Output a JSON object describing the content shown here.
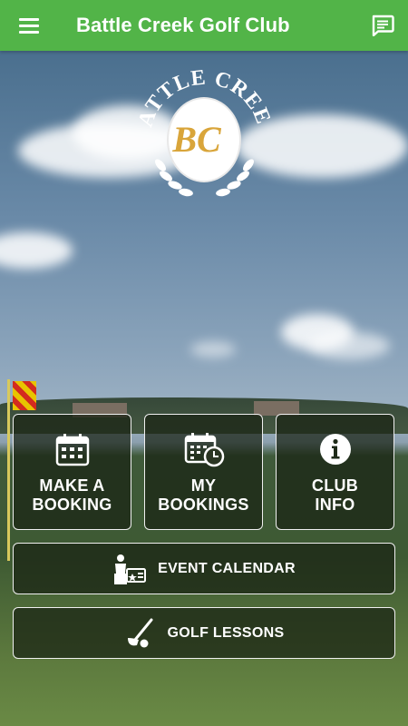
{
  "header": {
    "title": "Battle Creek Golf Club",
    "menu_icon": "hamburger-menu-icon",
    "messages_icon": "message-icon"
  },
  "logo": {
    "arc_text": "BATTLE CREEK",
    "monogram": "BC"
  },
  "tiles": [
    {
      "label_line1": "MAKE A",
      "label_line2": "BOOKING",
      "icon": "calendar-grid-icon"
    },
    {
      "label_line1": "MY",
      "label_line2": "BOOKINGS",
      "icon": "calendar-clock-icon"
    },
    {
      "label_line1": "CLUB",
      "label_line2": "INFO",
      "icon": "info-icon"
    }
  ],
  "wide_buttons": [
    {
      "label": "EVENT CALENDAR",
      "icon": "event-presenter-icon"
    },
    {
      "label": "GOLF LESSONS",
      "icon": "golf-club-icon"
    }
  ],
  "colors": {
    "header_bg": "#52b448",
    "tile_border": "#f0f0f0",
    "logo_gold": "#d9a53a",
    "logo_green": "#3a8a35"
  }
}
